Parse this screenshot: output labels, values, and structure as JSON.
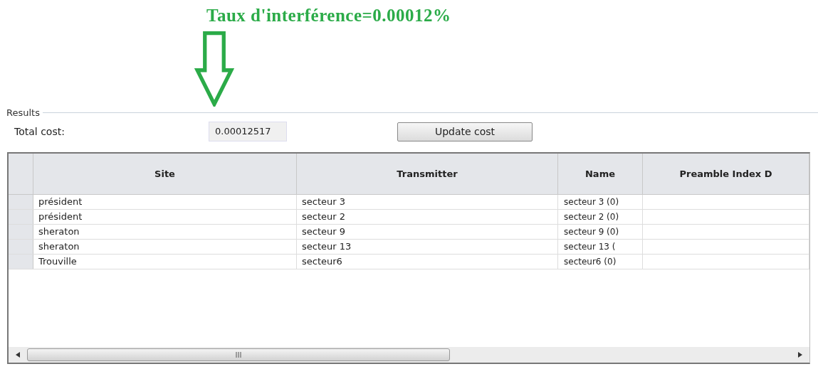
{
  "annotation": {
    "title": "Taux d'interférence=0.00012%"
  },
  "results": {
    "legend": "Results",
    "total_cost_label": "Total cost:",
    "total_cost_value": "0.00012517",
    "update_button": "Update cost"
  },
  "table": {
    "columns": [
      "Site",
      "Transmitter",
      "Name",
      "Preamble Index D"
    ],
    "rows": [
      {
        "cells": [
          "président",
          "secteur 3",
          "secteur 3 (0)",
          ""
        ]
      },
      {
        "cells": [
          "président",
          "secteur 2",
          "secteur 2 (0)",
          ""
        ]
      },
      {
        "cells": [
          "sheraton",
          "secteur 9",
          "secteur 9 (0)",
          ""
        ]
      },
      {
        "cells": [
          "sheraton",
          "secteur 13",
          "secteur 13 (",
          ""
        ]
      },
      {
        "cells": [
          "Trouville",
          "secteur6",
          "secteur6 (0)",
          ""
        ]
      }
    ]
  }
}
